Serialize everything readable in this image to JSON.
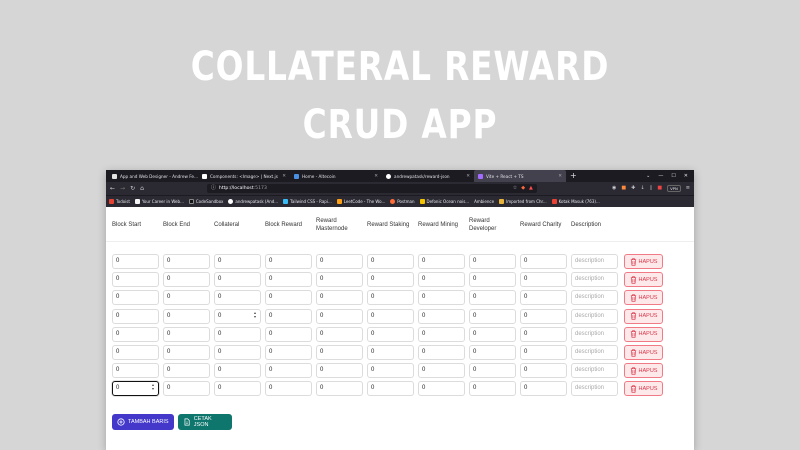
{
  "hero": {
    "line1": "COLLATERAL REWARD",
    "line2": "CRUD APP"
  },
  "browser": {
    "tabs": [
      {
        "label": "App and Web Designer - Andrew Fe...",
        "active": false
      },
      {
        "label": "Components: <Image> | Next.js",
        "active": false
      },
      {
        "label": "Home - Altecoin",
        "active": false
      },
      {
        "label": "andrewpatask/reward-json",
        "active": false
      },
      {
        "label": "Vite + React + TS",
        "active": true
      }
    ],
    "url": "http://localhost",
    "url_port": ":5173",
    "vpn": "VPN",
    "bookmarks": [
      {
        "label": "Todoist",
        "color": "#e44232"
      },
      {
        "label": "Your Career in Web...",
        "color": "#f5f5f5"
      },
      {
        "label": "CodeSandbox",
        "color": "#151515"
      },
      {
        "label": "andrewpatask (And...",
        "color": "#ffffff"
      },
      {
        "label": "Tailwind CSS - Rapi...",
        "color": "#38bdf8"
      },
      {
        "label": "LeetCode - The Wo...",
        "color": "#ffa116"
      },
      {
        "label": "Postman",
        "color": "#ff6c37"
      },
      {
        "label": "Defonic Ocean nois...",
        "color": "#f5c400"
      },
      {
        "label": "Ambience",
        "color": "#2b2a33"
      },
      {
        "label": "Imported from Chr...",
        "color": "#e8b339"
      },
      {
        "label": "Kotak Masuk (763)...",
        "color": "#ea4335"
      }
    ]
  },
  "table": {
    "headers": [
      "Block Start",
      "Block End",
      "Collateral",
      "Block Reward",
      "Reward Masternode",
      "Reward Staking",
      "Reward Mining",
      "Reward Developer",
      "Reward Charity",
      "Description"
    ],
    "description_placeholder": "description",
    "delete_label": "HAPUS",
    "rows": [
      [
        "0",
        "0",
        "0",
        "0",
        "0",
        "0",
        "0",
        "0",
        "0"
      ],
      [
        "0",
        "0",
        "0",
        "0",
        "0",
        "0",
        "0",
        "0",
        "0"
      ],
      [
        "0",
        "0",
        "0",
        "0",
        "0",
        "0",
        "0",
        "0",
        "0"
      ],
      [
        "0",
        "0",
        "0",
        "0",
        "0",
        "0",
        "0",
        "0",
        "0"
      ],
      [
        "0",
        "0",
        "0",
        "0",
        "0",
        "0",
        "0",
        "0",
        "0"
      ],
      [
        "0",
        "0",
        "0",
        "0",
        "0",
        "0",
        "0",
        "0",
        "0"
      ],
      [
        "0",
        "0",
        "0",
        "0",
        "0",
        "0",
        "0",
        "0",
        "0"
      ],
      [
        "0",
        "0",
        "0",
        "0",
        "0",
        "0",
        "0",
        "0",
        "0"
      ]
    ]
  },
  "actions": {
    "add_label": "TAMBAH BARIS",
    "print_label": "CETAK JSON"
  },
  "colors": {
    "add": "#4338ca",
    "print": "#0f766e",
    "delete_text": "#d9394b",
    "delete_bg": "#fde8ea"
  }
}
